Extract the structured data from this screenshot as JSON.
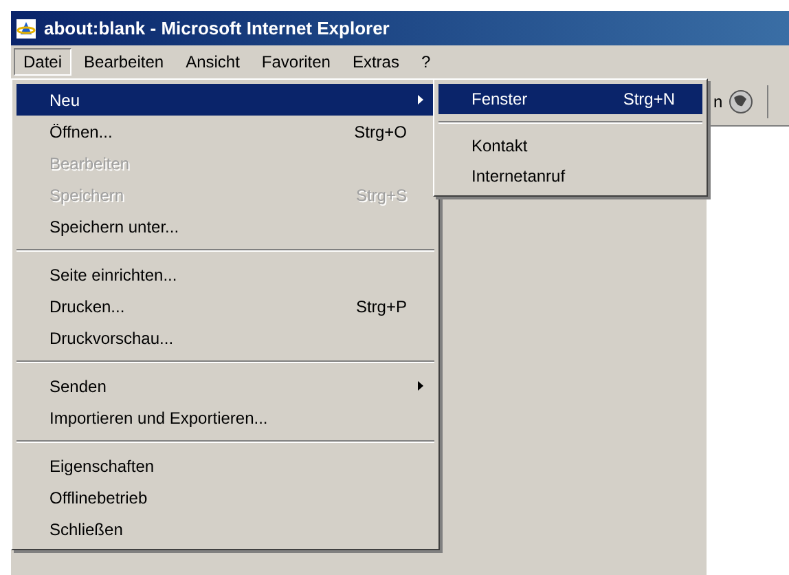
{
  "window": {
    "title": "about:blank - Microsoft Internet Explorer"
  },
  "menu_bar": [
    {
      "label": "Datei",
      "selected": true
    },
    {
      "label": "Bearbeiten",
      "selected": false
    },
    {
      "label": "Ansicht",
      "selected": false
    },
    {
      "label": "Favoriten",
      "selected": false
    },
    {
      "label": "Extras",
      "selected": false
    },
    {
      "label": "?",
      "selected": false
    }
  ],
  "toolbar": {
    "partial_label": "n"
  },
  "file_menu": [
    {
      "kind": "item",
      "label": "Neu",
      "submenu": true,
      "selected": true,
      "disabled": false
    },
    {
      "kind": "item",
      "label": "Öffnen...",
      "shortcut": "Strg+O",
      "selected": false,
      "disabled": false
    },
    {
      "kind": "item",
      "label": "Bearbeiten",
      "selected": false,
      "disabled": true
    },
    {
      "kind": "item",
      "label": "Speichern",
      "shortcut": "Strg+S",
      "selected": false,
      "disabled": true
    },
    {
      "kind": "item",
      "label": "Speichern unter...",
      "selected": false,
      "disabled": false
    },
    {
      "kind": "separator"
    },
    {
      "kind": "item",
      "label": "Seite einrichten...",
      "selected": false,
      "disabled": false
    },
    {
      "kind": "item",
      "label": "Drucken...",
      "shortcut": "Strg+P",
      "selected": false,
      "disabled": false
    },
    {
      "kind": "item",
      "label": "Druckvorschau...",
      "selected": false,
      "disabled": false
    },
    {
      "kind": "separator"
    },
    {
      "kind": "item",
      "label": "Senden",
      "submenu": true,
      "selected": false,
      "disabled": false
    },
    {
      "kind": "item",
      "label": "Importieren und Exportieren...",
      "selected": false,
      "disabled": false
    },
    {
      "kind": "separator"
    },
    {
      "kind": "item",
      "label": "Eigenschaften",
      "selected": false,
      "disabled": false
    },
    {
      "kind": "item",
      "label": "Offlinebetrieb",
      "selected": false,
      "disabled": false
    },
    {
      "kind": "item",
      "label": "Schließen",
      "selected": false,
      "disabled": false
    }
  ],
  "new_submenu": [
    {
      "kind": "item",
      "label": "Fenster",
      "shortcut": "Strg+N",
      "selected": true
    },
    {
      "kind": "separator"
    },
    {
      "kind": "item",
      "label": "Kontakt",
      "selected": false
    },
    {
      "kind": "item",
      "label": "Internetanruf",
      "selected": false
    }
  ]
}
